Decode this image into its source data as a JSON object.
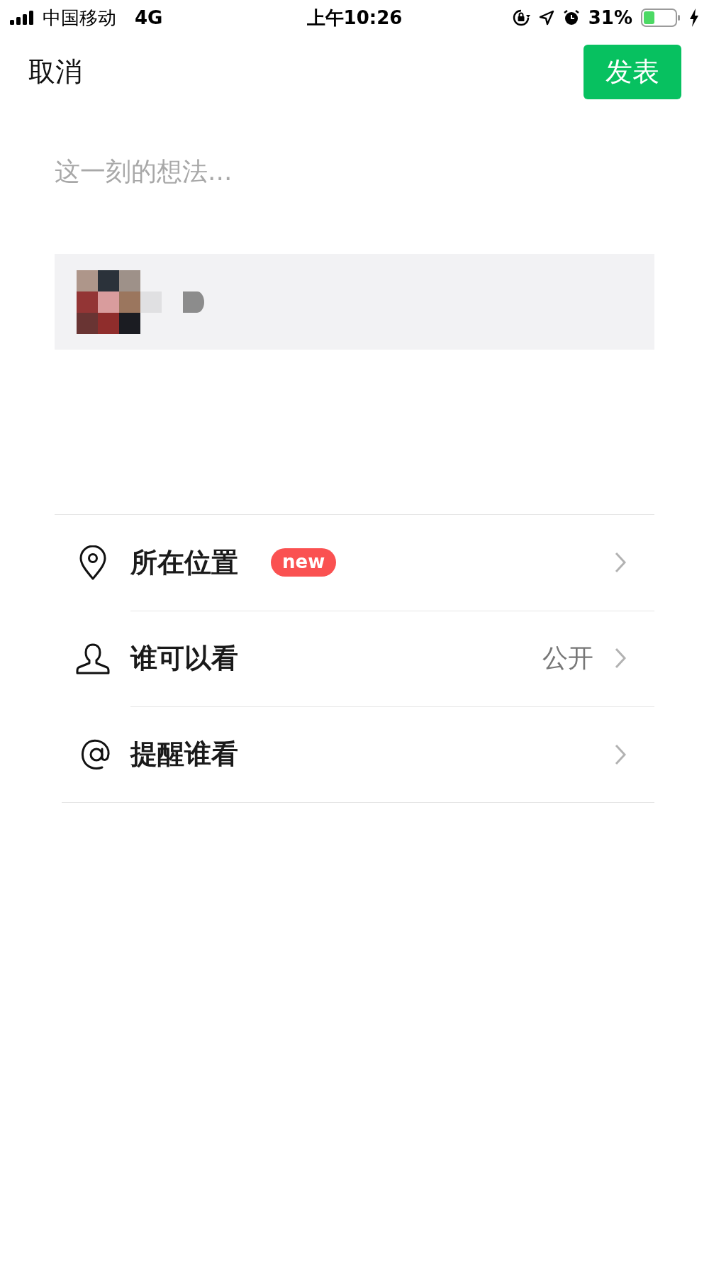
{
  "status_bar": {
    "carrier": "中国移动",
    "network": "4G",
    "time": "上午10:26",
    "battery": "31%"
  },
  "header": {
    "cancel": "取消",
    "publish": "发表"
  },
  "composer": {
    "placeholder": "这一刻的想法..."
  },
  "options": [
    {
      "kind": "location",
      "label": "所在位置",
      "badge": "new"
    },
    {
      "kind": "audience",
      "label": "谁可以看",
      "value": "公开"
    },
    {
      "kind": "mention",
      "label": "提醒谁看"
    }
  ]
}
